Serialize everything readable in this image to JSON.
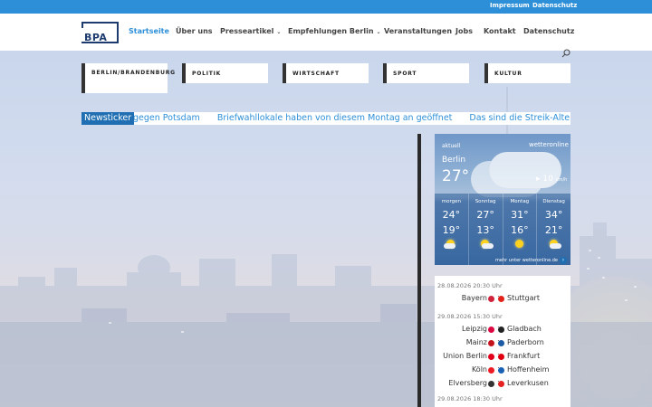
{
  "topbar": {
    "links": [
      "Impressum",
      "Datenschutz"
    ]
  },
  "header": {
    "logo": "BPA",
    "nav": [
      {
        "label": "Startseite",
        "active": true,
        "dropdown": false
      },
      {
        "label": "Über uns",
        "active": false,
        "dropdown": false
      },
      {
        "label": "Presseartikel",
        "active": false,
        "dropdown": true
      },
      {
        "label": "Empfehlungen Berlin",
        "active": false,
        "dropdown": true
      },
      {
        "label": "Veranstaltungen",
        "active": false,
        "dropdown": false
      },
      {
        "label": "Jobs",
        "active": false,
        "dropdown": false
      },
      {
        "label": "Kontakt",
        "active": false,
        "dropdown": false
      },
      {
        "label": "Datenschutz",
        "active": false,
        "dropdown": false
      }
    ]
  },
  "categories": [
    "BERLIN/BRANDENBURG",
    "POLITIK",
    "WIRTSCHAFT",
    "SPORT",
    "KULTUR"
  ],
  "ticker": {
    "label": "Newsticker",
    "items": [
      "gegen Potsdam",
      "Briefwahllokale haben von diesem Montag an geöffnet",
      "Das sind die Streik-Alternativ"
    ]
  },
  "weather": {
    "brand": "wetteronline",
    "small_label": "aktuell",
    "city": "Berlin",
    "temp": "27°",
    "wind": "10",
    "wind_unit": "km/h",
    "days": [
      {
        "name": "morgen",
        "hi": "24°",
        "lo": "19°",
        "icon": "sun-cloud-icon"
      },
      {
        "name": "Sonntag",
        "hi": "27°",
        "lo": "13°",
        "icon": "sun-cloud-icon"
      },
      {
        "name": "Montag",
        "hi": "31°",
        "lo": "16°",
        "icon": "sun-icon"
      },
      {
        "name": "Dienstag",
        "hi": "34°",
        "lo": "21°",
        "icon": "sun-cloud-icon"
      }
    ],
    "footer": "mehr unter wetteronline.de"
  },
  "fixtures": {
    "groups": [
      {
        "date": "28.08.2026 20:30 Uhr",
        "matches": [
          {
            "home": "Bayern",
            "away": "Stuttgart",
            "home_color": "#d1233c",
            "away_color": "#e32219"
          }
        ]
      },
      {
        "date": "29.08.2026 15:30 Uhr",
        "matches": [
          {
            "home": "Leipzig",
            "away": "Gladbach",
            "home_color": "#dd0741",
            "away_color": "#222222"
          },
          {
            "home": "Mainz",
            "away": "Paderborn",
            "home_color": "#c3141e",
            "away_color": "#1d5ba4"
          },
          {
            "home": "Union Berlin",
            "away": "Frankfurt",
            "home_color": "#e2001a",
            "away_color": "#e1000f"
          },
          {
            "home": "Köln",
            "away": "Hoffenheim",
            "home_color": "#ed1c24",
            "away_color": "#1961b5"
          },
          {
            "home": "Elversberg",
            "away": "Leverkusen",
            "home_color": "#333333",
            "away_color": "#e32221"
          }
        ]
      },
      {
        "date": "29.08.2026 18:30 Uhr",
        "matches": []
      }
    ]
  }
}
